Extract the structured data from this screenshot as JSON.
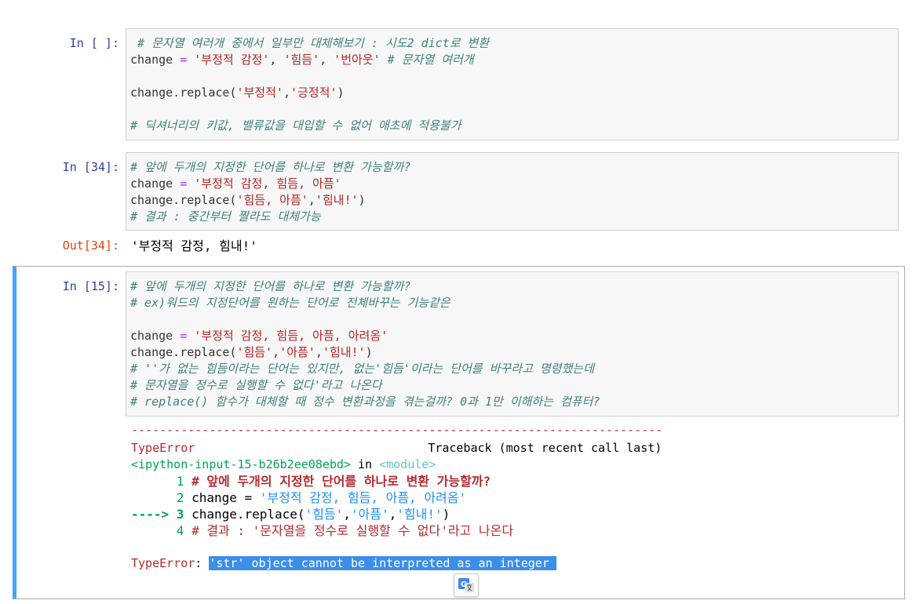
{
  "cells": [
    {
      "prompt": "In [ ]:",
      "lines": [
        [
          {
            "t": " # 문자열 여러개 중에서 일부만 대체해보기 : 시도2 dict로 변환",
            "c": "cm"
          }
        ],
        [
          {
            "t": "change ",
            "c": ""
          },
          {
            "t": "=",
            "c": "op"
          },
          {
            "t": " ",
            "c": ""
          },
          {
            "t": "'부정적 감정'",
            "c": "st"
          },
          {
            "t": ", ",
            "c": ""
          },
          {
            "t": "'힘듬'",
            "c": "st"
          },
          {
            "t": ", ",
            "c": ""
          },
          {
            "t": "'번아웃'",
            "c": "st"
          },
          {
            "t": " ",
            "c": ""
          },
          {
            "t": "# 문자열 여러개",
            "c": "cm"
          }
        ],
        [],
        [
          {
            "t": "change.replace(",
            "c": ""
          },
          {
            "t": "'부정적'",
            "c": "st"
          },
          {
            "t": ",",
            "c": ""
          },
          {
            "t": "'긍정적'",
            "c": "st"
          },
          {
            "t": ")",
            "c": ""
          }
        ],
        [],
        [
          {
            "t": "# 딕셔너리의 키값, 밸류값을 대입할 수 없어 애초에 적용불가",
            "c": "cm"
          }
        ]
      ]
    },
    {
      "prompt": "In [34]:",
      "lines": [
        [
          {
            "t": "# 앞에 두개의 지정한 단어를 하나로 변환 가능할까?",
            "c": "cm"
          }
        ],
        [
          {
            "t": "change ",
            "c": ""
          },
          {
            "t": "=",
            "c": "op"
          },
          {
            "t": " ",
            "c": ""
          },
          {
            "t": "'부정적 감정, 힘듬, 아픔'",
            "c": "st"
          }
        ],
        [
          {
            "t": "change.replace(",
            "c": ""
          },
          {
            "t": "'힘듬, 아픔'",
            "c": "st"
          },
          {
            "t": ",",
            "c": ""
          },
          {
            "t": "'힘내!'",
            "c": "st"
          },
          {
            "t": ")",
            "c": ""
          }
        ],
        [
          {
            "t": "# 결과 : 중간부터 짤라도 대체가능",
            "c": "cm"
          }
        ]
      ]
    },
    {
      "prompt": "In [15]:",
      "lines": [
        [
          {
            "t": "# 앞에 두개의 지정한 단어를 하나로 변환 가능할까?",
            "c": "cm"
          }
        ],
        [
          {
            "t": "# ex)워드의 지정단어를 원하는 단어로 전체바꾸는 기능같은",
            "c": "cm"
          }
        ],
        [],
        [
          {
            "t": "change ",
            "c": ""
          },
          {
            "t": "=",
            "c": "op"
          },
          {
            "t": " ",
            "c": ""
          },
          {
            "t": "'부정적 감정, 힘듬, 아픔, 아려옴'",
            "c": "st"
          }
        ],
        [
          {
            "t": "change.replace(",
            "c": ""
          },
          {
            "t": "'힘듬'",
            "c": "st"
          },
          {
            "t": ",",
            "c": ""
          },
          {
            "t": "'아픔'",
            "c": "st"
          },
          {
            "t": ",",
            "c": ""
          },
          {
            "t": "'힘내!'",
            "c": "st"
          },
          {
            "t": ")",
            "c": ""
          }
        ],
        [
          {
            "t": "# ''가 없는 힘듬이라는 단어는 있지만, 없는'힘듬'이라는 단어를 바꾸라고 명령했는데",
            "c": "cm"
          }
        ],
        [
          {
            "t": "# 문자열을 정수로 실행할 수 없다'라고 나온다",
            "c": "cm"
          }
        ],
        [
          {
            "t": "# replace() 함수가 대체할 때 정수 변환과정을 겪는걸까? 0과 1만 이해하는 컴퓨터?",
            "c": "cm"
          }
        ]
      ]
    }
  ],
  "out34": {
    "prompt": "Out[34]:",
    "text": "'부정적 감정, 힘내!'"
  },
  "traceback": {
    "separator": "---------------------------------------------------------------------------",
    "error_name": "TypeError",
    "header_right": "Traceback (most recent call last)",
    "input_ref": "<ipython-input-15-b26b2ee08ebd>",
    "in_word": " in ",
    "module": "<module>",
    "line1_no": "      1 ",
    "line1_code": "# 앞에 두개의 지정한 단어를 하나로 변환 가능할까?",
    "line2_no": "      2 ",
    "line2_code_a": "change ",
    "line2_code_op": "=",
    "line2_code_str": " '부정적 감정, 힘듬, 아픔, 아려옴'",
    "line3_arrow": "----> 3 ",
    "line3_code_a": "change.replace(",
    "line3_s1": "'힘듬'",
    "line3_s2": "'아픔'",
    "line3_s3": "'힘내!'",
    "line3_close": ")",
    "line4_no": "      4 ",
    "line4_code": "# 결과 : '문자열을 정수로 실행할 수 없다'라고 나온다",
    "final_name": "TypeError",
    "final_colon": ": ",
    "final_message": "'str' object cannot be interpreted as an integer "
  },
  "icons": {
    "translate": "google-translate-icon"
  },
  "colors": {
    "selected_cell_border": "#42a5f5",
    "input_prompt": "#303f9f",
    "output_prompt": "#d84315",
    "selection": "#3b8eea"
  }
}
